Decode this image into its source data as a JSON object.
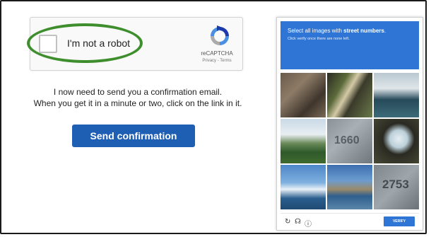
{
  "recaptcha": {
    "checkbox_label": "I'm not a robot",
    "brand": "reCAPTCHA",
    "terms": "Privacy - Terms"
  },
  "message": {
    "line1": "I now need to send you a confirmation email.",
    "line2": "When you get it in a minute or two, click on the link in it."
  },
  "send_button_label": "Send confirmation",
  "challenge": {
    "title_prefix": "Select all images with ",
    "title_bold": "street numbers",
    "title_suffix": ".",
    "subtitle": "Click verify once there are none left.",
    "tiles": [
      {
        "number": ""
      },
      {
        "number": ""
      },
      {
        "number": ""
      },
      {
        "number": ""
      },
      {
        "number": "1660"
      },
      {
        "number": ""
      },
      {
        "number": ""
      },
      {
        "number": ""
      },
      {
        "number": "2753"
      }
    ],
    "verify_label": "VERIFY",
    "icons": [
      "reload-icon",
      "audio-icon",
      "info-icon"
    ]
  },
  "colors": {
    "button_blue": "#1f5fb3",
    "challenge_blue": "#2f75d6",
    "highlight_green": "#3e8e2e"
  }
}
